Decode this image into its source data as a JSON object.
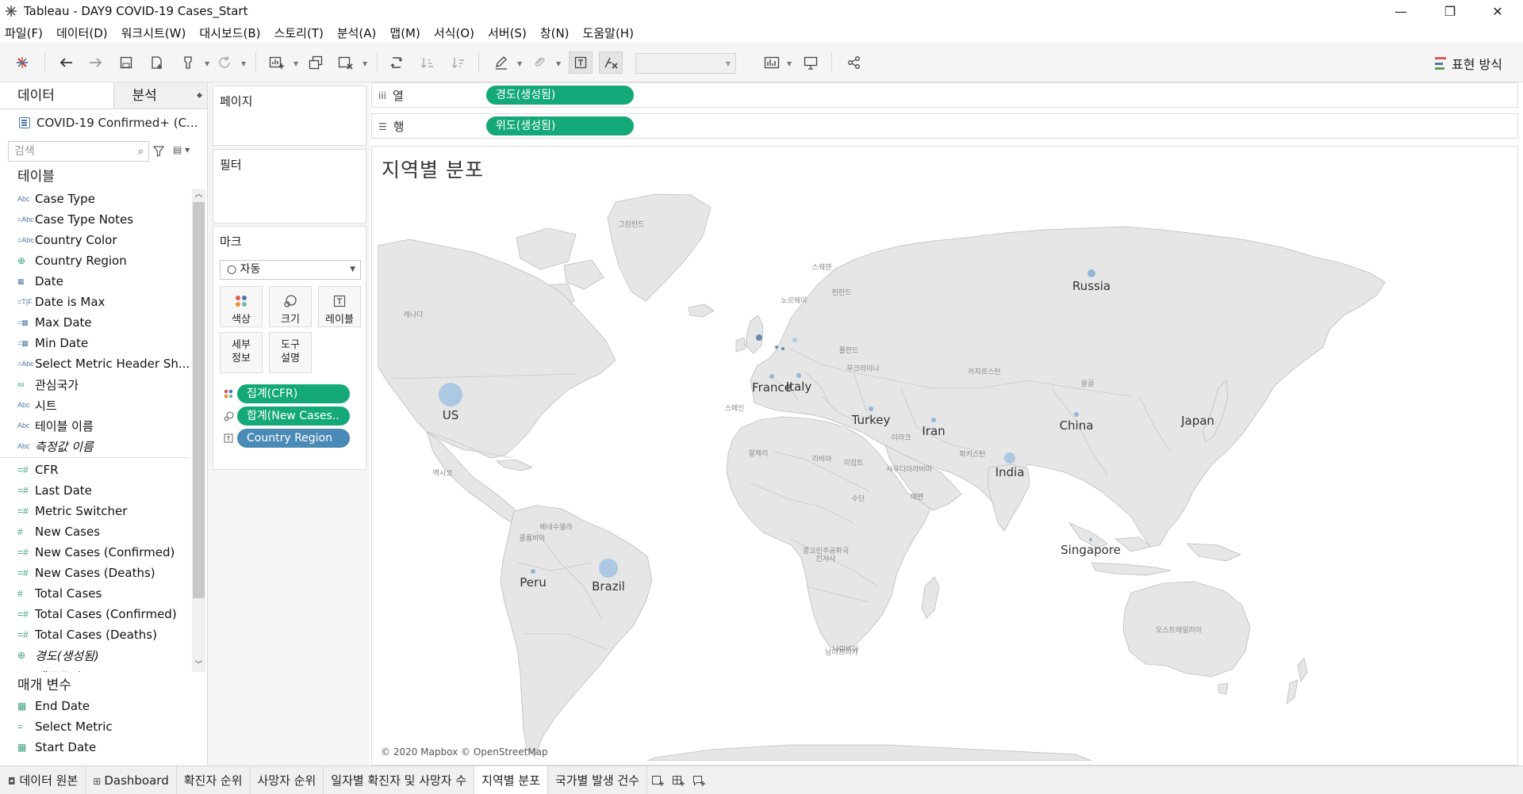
{
  "window": {
    "title": "Tableau - DAY9 COVID-19 Cases_Start",
    "minimize": "—",
    "restore": "❐",
    "close": "✕"
  },
  "menu": [
    "파일(F)",
    "데이터(D)",
    "워크시트(W)",
    "대시보드(B)",
    "스토리(T)",
    "분석(A)",
    "맵(M)",
    "서식(O)",
    "서버(S)",
    "창(N)",
    "도움말(H)"
  ],
  "toolbar": {
    "show_me_label": "표현 방식"
  },
  "data_pane": {
    "tab_data": "데이터",
    "tab_analysis": "분석",
    "datasource": "COVID-19 Confirmed+ (C...",
    "search_placeholder": "검색",
    "tables_title": "테이블",
    "fields": [
      {
        "icon": "Abc",
        "name": "Case Type"
      },
      {
        "icon": "=Abc",
        "name": "Case Type Notes"
      },
      {
        "icon": "=Abc",
        "name": "Country Color"
      },
      {
        "icon": "⊕",
        "name": "Country Region"
      },
      {
        "icon": "▦",
        "name": "Date"
      },
      {
        "icon": "=T|F",
        "name": "Date is Max"
      },
      {
        "icon": "=▦",
        "name": "Max Date"
      },
      {
        "icon": "=▦",
        "name": "Min Date"
      },
      {
        "icon": "=Abc",
        "name": "Select Metric Header Sh..."
      },
      {
        "icon": "∞",
        "name": "관심국가"
      },
      {
        "icon": "Abc",
        "name": "시트"
      },
      {
        "icon": "Abc",
        "name": "테이블 이름"
      },
      {
        "icon": "Abc",
        "name": "측정값 이름",
        "italic": true
      }
    ],
    "measures": [
      {
        "icon": "=#",
        "name": "CFR"
      },
      {
        "icon": "=#",
        "name": "Last Date"
      },
      {
        "icon": "=#",
        "name": "Metric Switcher"
      },
      {
        "icon": "#",
        "name": "New Cases"
      },
      {
        "icon": "=#",
        "name": "New Cases (Confirmed)"
      },
      {
        "icon": "=#",
        "name": "New Cases (Deaths)"
      },
      {
        "icon": "#",
        "name": "Total Cases"
      },
      {
        "icon": "=#",
        "name": "Total Cases (Confirmed)"
      },
      {
        "icon": "=#",
        "name": "Total Cases (Deaths)"
      },
      {
        "icon": "⊕",
        "name": "경도(생성됨)",
        "italic": true
      },
      {
        "icon": "#",
        "name": "레코드 수",
        "italic": true
      }
    ],
    "params_title": "매개 변수",
    "params": [
      {
        "icon": "▦",
        "name": "End Date"
      },
      {
        "icon": "=",
        "name": "Select Metric"
      },
      {
        "icon": "▦",
        "name": "Start Date"
      }
    ]
  },
  "shelves": {
    "pages_title": "페이지",
    "filters_title": "필터",
    "marks_title": "마크",
    "marks_type": "○ 자동",
    "columns_label": "열",
    "rows_label": "행",
    "columns_pill": "경도(생성됨)",
    "rows_pill": "위도(생성됨)",
    "marks_buttons": {
      "color": "색상",
      "size": "크기",
      "label": "레이블",
      "detail": "세부\n정보",
      "tooltip": "도구\n설명"
    },
    "marks_pills": [
      {
        "name": "집계(CFR)",
        "type": "color"
      },
      {
        "name": "합계(New Cases..",
        "type": "size"
      },
      {
        "name": "Country Region",
        "type": "label"
      }
    ]
  },
  "worksheet": {
    "title": "지역별 분포",
    "credit": "© 2020 Mapbox © OpenStreetMap",
    "country_labels": [
      "Russia",
      "France",
      "Italy",
      "Turkey",
      "US",
      "Iran",
      "China",
      "Japan",
      "India",
      "Singapore",
      "Peru",
      "Brazil"
    ],
    "base_labels": [
      "그린란드",
      "스웨덴",
      "핀란드",
      "노르웨이",
      "캐나다",
      "폴란드",
      "우크라이나",
      "카자흐스탄",
      "몽골",
      "스페인",
      "이라크",
      "알제리",
      "리비아",
      "이집트",
      "사우디아라비아",
      "파키스탄",
      "예멘",
      "수단",
      "멕시코",
      "베네수엘라",
      "콜롬비아",
      "콩고민주공화국",
      "킨샤사",
      "나미비아",
      "오스트레일리아",
      "남아프리카"
    ]
  },
  "bottom_tabs": [
    "데이터 원본",
    "Dashboard",
    "확진자 순위",
    "사망자 순위",
    "일자별 확진자 및 사망자 수",
    "지역별 분포",
    "국가별 발생 건수"
  ],
  "active_tab": "지역별 분포"
}
